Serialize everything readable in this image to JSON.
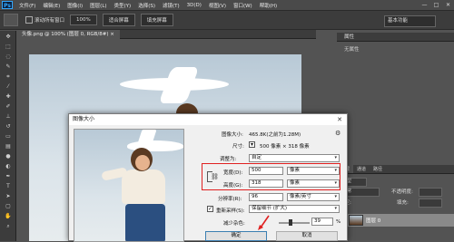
{
  "menubar": {
    "app_badge": "Ps",
    "items": [
      "文件(F)",
      "编辑(E)",
      "图像(I)",
      "图层(L)",
      "类型(Y)",
      "选择(S)",
      "滤镜(T)",
      "3D(D)",
      "视图(V)",
      "窗口(W)",
      "帮助(H)"
    ],
    "window_controls": [
      "—",
      "□",
      "✕"
    ]
  },
  "options_bar": {
    "checkbox_label": "滚动所有窗口",
    "buttons": [
      "100%",
      "适合屏幕",
      "填充屏幕"
    ],
    "workspace": "基本功能"
  },
  "document": {
    "tab_title": "头像.png @ 100% (图层 0, RGB/8#) ×"
  },
  "panels": {
    "properties_title": "属性",
    "properties_body": "无属性",
    "layer_tabs": [
      "图层",
      "通道",
      "路径"
    ],
    "kind_filter": "类型",
    "blend_mode": "正常",
    "opacity_label": "不透明度:",
    "lock_label": "锁定:",
    "fill_label": "填充:",
    "layer_name": "图层 0"
  },
  "dialog": {
    "title": "图像大小",
    "image_size_label": "图像大小:",
    "image_size_value": "465.8K(之前为1.28M)",
    "dimensions_label": "尺寸:",
    "dimensions_value": "500 像素 × 318 像素",
    "fit_to_label": "调整为:",
    "fit_to_value": "自定",
    "width_label": "宽度(D):",
    "width_value": "500",
    "width_unit": "像素",
    "height_label": "高度(G):",
    "height_value": "318",
    "height_unit": "像素",
    "resolution_label": "分辨率(R):",
    "resolution_value": "96",
    "resolution_unit": "像素/英寸",
    "resample_label": "重新采样(S):",
    "resample_value": "保留细节 (扩大)",
    "resample_checked": true,
    "noise_label": "减少杂色:",
    "noise_value": "39",
    "noise_unit": "%",
    "noise_level": 0.39,
    "ok_label": "确定",
    "cancel_label": "取消"
  },
  "colors": {
    "highlight": "#e02020",
    "ps_blue": "#31a8ff"
  }
}
